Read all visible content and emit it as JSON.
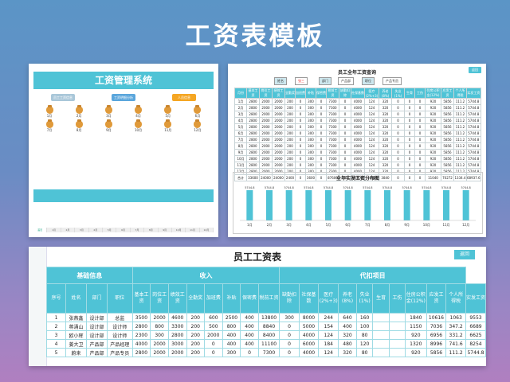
{
  "page_title": "工资表模板",
  "system": {
    "title": "工资管理系统",
    "buttons": [
      {
        "label": "员工工资信息",
        "color": "#a9c7d9"
      },
      {
        "label": "工资明细分析",
        "color": "#5aa6dc"
      },
      {
        "label": "人员信息",
        "color": "#f5a623"
      }
    ],
    "bag_rows": [
      [
        "1月",
        "2月",
        "3月",
        "4月",
        "5月",
        "6月"
      ],
      [
        "7月",
        "8月",
        "9月",
        "10月",
        "11月",
        "12月"
      ]
    ],
    "tabs": [
      "首页",
      "1月",
      "2月",
      "3月",
      "4月",
      "5月",
      "6月",
      "7月",
      "8月",
      "9月",
      "10月",
      "11月",
      "12月"
    ]
  },
  "query": {
    "title": "员工全年工资查询",
    "return_label": "返回",
    "filters": [
      {
        "label": "姓名",
        "type": "lab"
      },
      {
        "label": "张三",
        "type": "red"
      },
      {
        "label": "部门",
        "type": "lab"
      },
      {
        "label": "产品部",
        "type": "val"
      },
      {
        "label": "职位",
        "type": "lab"
      },
      {
        "label": "产品专员",
        "type": "val"
      }
    ],
    "headers": [
      "月份",
      "基本工资",
      "岗位工资",
      "绩效工资",
      "全勤奖",
      "加班费",
      "补贴",
      "保密费",
      "税前工资",
      "缺勤扣除",
      "社保基数",
      "医疗(2%+3)",
      "养老(8%)",
      "失业(1%)",
      "生育",
      "工伤",
      "住房公积金(12%)",
      "应发工资",
      "个人所得税",
      "实发工资"
    ],
    "rows": [
      [
        "1月",
        "2800",
        "2000",
        "2000",
        "200",
        "0",
        "300",
        "0",
        "7300",
        "0",
        "4000",
        "124",
        "320",
        "0",
        "0",
        "0",
        "920",
        "5856",
        "111.2",
        "5744.8"
      ],
      [
        "2月",
        "2800",
        "2000",
        "2000",
        "200",
        "0",
        "300",
        "0",
        "7300",
        "0",
        "4000",
        "124",
        "320",
        "0",
        "0",
        "0",
        "920",
        "5856",
        "111.2",
        "5744.8"
      ],
      [
        "3月",
        "2800",
        "2000",
        "2000",
        "200",
        "0",
        "300",
        "0",
        "7300",
        "0",
        "4000",
        "124",
        "320",
        "0",
        "0",
        "0",
        "920",
        "5856",
        "111.2",
        "5744.8"
      ],
      [
        "4月",
        "2800",
        "2000",
        "2000",
        "200",
        "0",
        "300",
        "0",
        "7300",
        "0",
        "4000",
        "124",
        "320",
        "0",
        "0",
        "0",
        "920",
        "5856",
        "111.2",
        "5744.8"
      ],
      [
        "5月",
        "2800",
        "2000",
        "2000",
        "200",
        "0",
        "300",
        "0",
        "7300",
        "0",
        "4000",
        "124",
        "320",
        "0",
        "0",
        "0",
        "920",
        "5856",
        "111.2",
        "5744.8"
      ],
      [
        "6月",
        "2800",
        "2000",
        "2000",
        "200",
        "0",
        "300",
        "0",
        "7300",
        "0",
        "4000",
        "124",
        "320",
        "0",
        "0",
        "0",
        "920",
        "5856",
        "111.2",
        "5744.8"
      ],
      [
        "7月",
        "2800",
        "2000",
        "2000",
        "200",
        "0",
        "300",
        "0",
        "7300",
        "0",
        "4000",
        "124",
        "320",
        "0",
        "0",
        "0",
        "920",
        "5856",
        "111.2",
        "5744.8"
      ],
      [
        "8月",
        "2800",
        "2000",
        "2000",
        "200",
        "0",
        "300",
        "0",
        "7300",
        "0",
        "4000",
        "124",
        "320",
        "0",
        "0",
        "0",
        "920",
        "5856",
        "111.2",
        "5744.8"
      ],
      [
        "9月",
        "2800",
        "2000",
        "2000",
        "200",
        "0",
        "300",
        "0",
        "7300",
        "0",
        "4000",
        "124",
        "320",
        "0",
        "0",
        "0",
        "920",
        "5856",
        "111.2",
        "5744.8"
      ],
      [
        "10月",
        "2800",
        "2000",
        "2000",
        "200",
        "0",
        "300",
        "0",
        "7300",
        "0",
        "4000",
        "124",
        "320",
        "0",
        "0",
        "0",
        "920",
        "5856",
        "111.2",
        "5744.8"
      ],
      [
        "11月",
        "2800",
        "2000",
        "2000",
        "200",
        "0",
        "300",
        "0",
        "7300",
        "0",
        "4000",
        "124",
        "320",
        "0",
        "0",
        "0",
        "920",
        "5856",
        "111.2",
        "5744.8"
      ],
      [
        "12月",
        "2800",
        "2000",
        "2000",
        "200",
        "0",
        "300",
        "0",
        "7300",
        "0",
        "4000",
        "124",
        "320",
        "0",
        "0",
        "0",
        "920",
        "5856",
        "111.2",
        "5744.8"
      ],
      [
        "合计",
        "33600",
        "24000",
        "24000",
        "2400",
        "0",
        "3600",
        "0",
        "87600",
        "0",
        "48000",
        "1488",
        "3840",
        "0",
        "0",
        "0",
        "11040",
        "70272",
        "1334.4",
        "68937.6"
      ]
    ]
  },
  "chart_data": {
    "type": "bar",
    "title": "全年实发工资分布图",
    "categories": [
      "1月",
      "2月",
      "3月",
      "4月",
      "5月",
      "6月",
      "7月",
      "8月",
      "9月",
      "10月",
      "11月",
      "12月"
    ],
    "values": [
      5744.8,
      5744.8,
      5744.8,
      5744.8,
      5744.8,
      5744.8,
      5744.8,
      5744.8,
      5744.8,
      5744.8,
      5744.8,
      5744.8
    ],
    "color": "#4fc3d6",
    "ylim": [
      0,
      5744.8
    ]
  },
  "payroll": {
    "title": "员工工资表",
    "return_label": "返回",
    "groups": [
      {
        "label": "基础信息",
        "span": 4
      },
      {
        "label": "收入",
        "span": 8
      },
      {
        "label": "代扣项目",
        "span": 10
      }
    ],
    "headers": [
      "序号",
      "姓名",
      "部门",
      "职位",
      "基本工资",
      "岗位工资",
      "绩效工资",
      "全勤奖",
      "加班费",
      "补贴",
      "保密费",
      "税前工资",
      "缺勤扣除",
      "社保基数",
      "医疗(2%+3)",
      "养老(8%)",
      "失业(1%)",
      "生育",
      "工伤",
      "住房公积金(12%)",
      "应发工资",
      "个人所得税",
      "实发工资"
    ],
    "rows": [
      [
        "1",
        "张燕鑫",
        "设计部",
        "总监",
        "3500",
        "2000",
        "4600",
        "200",
        "600",
        "2500",
        "400",
        "13800",
        "300",
        "8000",
        "244",
        "640",
        "160",
        "",
        "",
        "1840",
        "10616",
        "1063",
        "9553"
      ],
      [
        "2",
        "蒋涌山",
        "设计部",
        "设计师",
        "2800",
        "800",
        "3300",
        "200",
        "500",
        "800",
        "400",
        "8840",
        "0",
        "5000",
        "154",
        "400",
        "100",
        "",
        "",
        "1150",
        "7036",
        "347.2",
        "6689"
      ],
      [
        "3",
        "欧小辉",
        "设计部",
        "设计师",
        "2300",
        "300",
        "2800",
        "200",
        "2000",
        "400",
        "400",
        "8400",
        "0",
        "4000",
        "124",
        "320",
        "80",
        "",
        "",
        "920",
        "6956",
        "331.2",
        "6625"
      ],
      [
        "4",
        "姜大卫",
        "产品部",
        "产品经理",
        "4000",
        "2000",
        "3000",
        "200",
        "0",
        "400",
        "400",
        "11100",
        "0",
        "6000",
        "184",
        "480",
        "120",
        "",
        "",
        "1320",
        "8996",
        "741.6",
        "8254"
      ],
      [
        "5",
        "蔚来",
        "产品部",
        "产品专员",
        "2800",
        "2000",
        "2000",
        "200",
        "0",
        "300",
        "0",
        "7300",
        "0",
        "4000",
        "124",
        "320",
        "80",
        "",
        "",
        "920",
        "5856",
        "111.2",
        "5744.8"
      ]
    ]
  }
}
